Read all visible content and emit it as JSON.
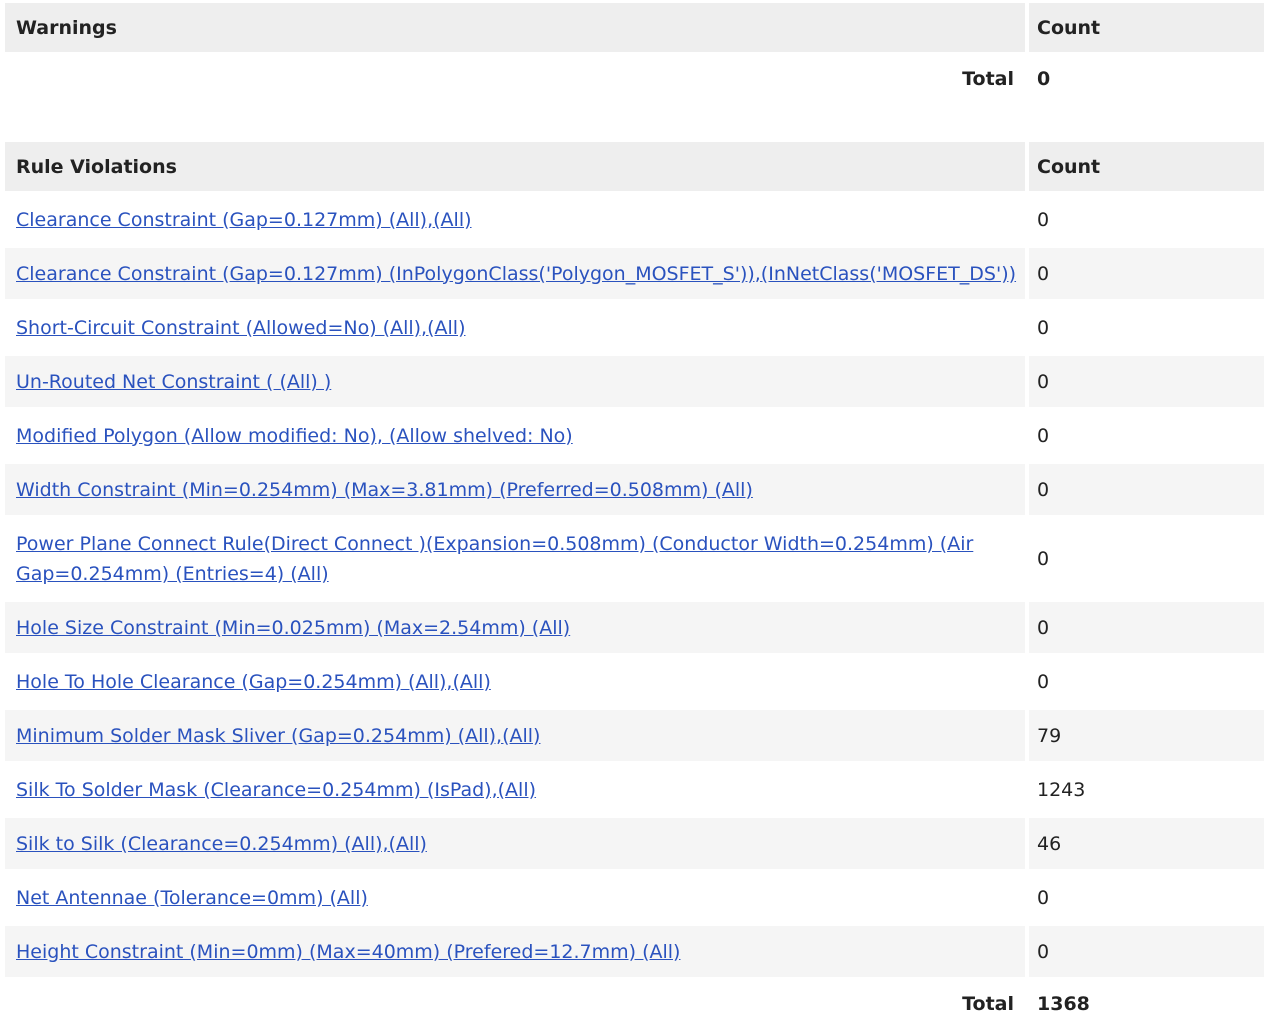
{
  "warnings": {
    "header": "Warnings",
    "count_header": "Count",
    "total_label": "Total",
    "total_value": "0"
  },
  "violations": {
    "header": "Rule Violations",
    "count_header": "Count",
    "total_label": "Total",
    "total_value": "1368",
    "rows": [
      {
        "rule": "Clearance Constraint (Gap=0.127mm) (All),(All)",
        "count": "0"
      },
      {
        "rule": "Clearance Constraint (Gap=0.127mm) (InPolygonClass('Polygon_MOSFET_S')),(InNetClass('MOSFET_DS'))",
        "count": "0"
      },
      {
        "rule": "Short-Circuit Constraint (Allowed=No) (All),(All)",
        "count": "0"
      },
      {
        "rule": "Un-Routed Net Constraint ( (All) )",
        "count": "0"
      },
      {
        "rule": "Modified Polygon (Allow modified: No), (Allow shelved: No)",
        "count": "0"
      },
      {
        "rule": "Width Constraint (Min=0.254mm) (Max=3.81mm) (Preferred=0.508mm) (All)",
        "count": "0"
      },
      {
        "rule": "Power Plane Connect Rule(Direct Connect )(Expansion=0.508mm) (Conductor Width=0.254mm) (Air Gap=0.254mm) (Entries=4) (All)",
        "count": "0"
      },
      {
        "rule": "Hole Size Constraint (Min=0.025mm) (Max=2.54mm) (All)",
        "count": "0"
      },
      {
        "rule": "Hole To Hole Clearance (Gap=0.254mm) (All),(All)",
        "count": "0"
      },
      {
        "rule": "Minimum Solder Mask Sliver (Gap=0.254mm) (All),(All)",
        "count": "79"
      },
      {
        "rule": "Silk To Solder Mask (Clearance=0.254mm) (IsPad),(All)",
        "count": "1243"
      },
      {
        "rule": "Silk to Silk (Clearance=0.254mm) (All),(All)",
        "count": "46"
      },
      {
        "rule": "Net Antennae (Tolerance=0mm) (All)",
        "count": "0"
      },
      {
        "rule": "Height Constraint (Min=0mm) (Max=40mm) (Prefered=12.7mm) (All)",
        "count": "0"
      }
    ]
  }
}
